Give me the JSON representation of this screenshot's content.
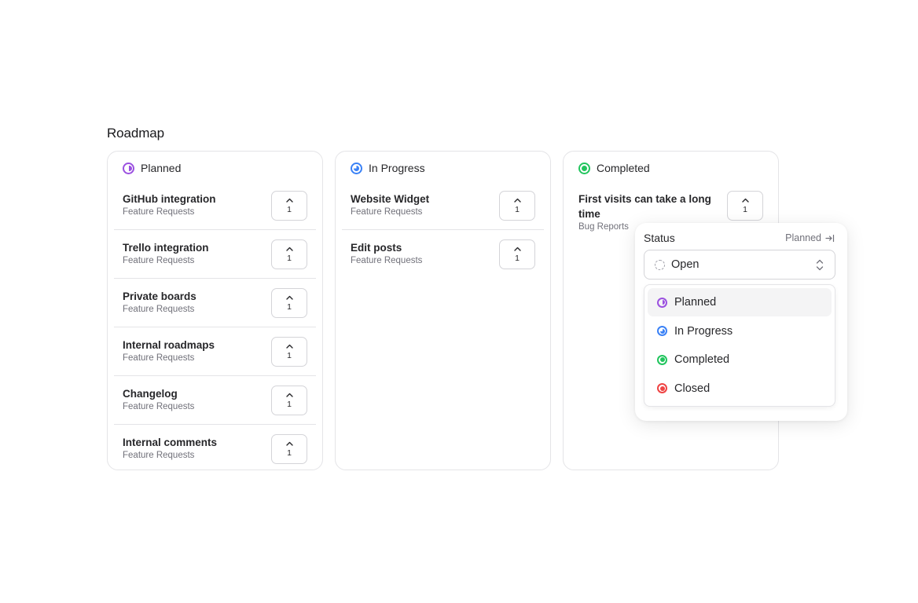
{
  "page": {
    "title": "Roadmap"
  },
  "columns": [
    {
      "label": "Planned",
      "status": "planned",
      "cards": [
        {
          "title": "GitHub integration",
          "category": "Feature Requests",
          "votes": "1"
        },
        {
          "title": "Trello integration",
          "category": "Feature Requests",
          "votes": "1"
        },
        {
          "title": "Private boards",
          "category": "Feature Requests",
          "votes": "1"
        },
        {
          "title": "Internal roadmaps",
          "category": "Feature Requests",
          "votes": "1"
        },
        {
          "title": "Changelog",
          "category": "Feature Requests",
          "votes": "1"
        },
        {
          "title": "Internal comments",
          "category": "Feature Requests",
          "votes": "1"
        }
      ]
    },
    {
      "label": "In Progress",
      "status": "in-progress",
      "cards": [
        {
          "title": "Website Widget",
          "category": "Feature Requests",
          "votes": "1"
        },
        {
          "title": "Edit posts",
          "category": "Feature Requests",
          "votes": "1"
        }
      ]
    },
    {
      "label": "Completed",
      "status": "completed",
      "cards": [
        {
          "title": "First visits can take a long time",
          "category": "Bug Reports",
          "votes": "1"
        }
      ]
    }
  ],
  "status_popover": {
    "label": "Status",
    "current_link": "Planned",
    "select": {
      "value": "Open",
      "icon": "dashed-circle-icon"
    },
    "options": [
      {
        "label": "Planned",
        "status": "planned",
        "color": "#9b51e0",
        "active": true
      },
      {
        "label": "In Progress",
        "status": "in-progress",
        "color": "#3b82f6",
        "active": false
      },
      {
        "label": "Completed",
        "status": "completed",
        "color": "#22c55e",
        "active": false
      },
      {
        "label": "Closed",
        "status": "closed",
        "color": "#ef4444",
        "active": false
      }
    ]
  },
  "colors": {
    "planned": "#9b51e0",
    "in_progress": "#3b82f6",
    "completed": "#22c55e",
    "closed": "#ef4444",
    "border": "#e4e4e7",
    "muted_text": "#71717a"
  }
}
